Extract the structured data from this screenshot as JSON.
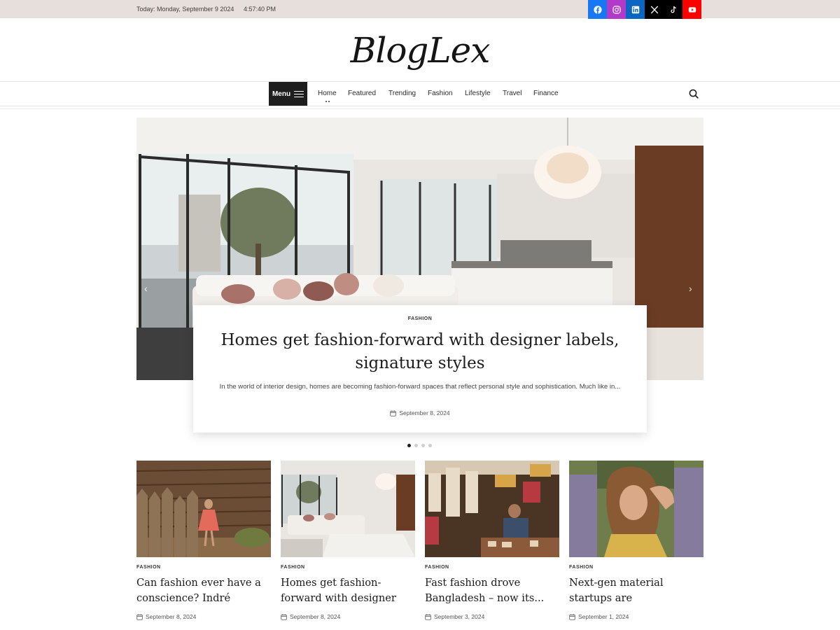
{
  "topbar": {
    "date": "Today: Monday, September 9 2024",
    "time": "4:57:40 PM",
    "social": [
      {
        "name": "facebook-icon",
        "color": "#1877f2"
      },
      {
        "name": "instagram-icon",
        "color": "#b23ac9"
      },
      {
        "name": "linkedin-icon",
        "color": "#0a66c2"
      },
      {
        "name": "x-icon",
        "color": "#000000"
      },
      {
        "name": "tiktok-icon",
        "color": "#000000"
      },
      {
        "name": "youtube-icon",
        "color": "#ff0000"
      }
    ]
  },
  "logo": "BlogLex",
  "nav": {
    "menu_label": "Menu",
    "items": [
      "Home",
      "Featured",
      "Trending",
      "Fashion",
      "Lifestyle",
      "Travel",
      "Finance"
    ],
    "search_icon": "search-icon"
  },
  "hero": {
    "category": "FASHION",
    "title": "Homes get fashion-forward with designer labels, signature styles",
    "excerpt": "In the world of interior design, homes are becoming fashion-forward spaces that reflect personal style and sophistication. Much like in...",
    "date": "September 8, 2024",
    "slides_total": 4,
    "active_slide": 1
  },
  "posts": [
    {
      "category": "FASHION",
      "title": "Can fashion ever have a conscience? Indré Rockefell...",
      "date": "September 8, 2024"
    },
    {
      "category": "FASHION",
      "title": "Homes get fashion-forward with designer labels,...",
      "date": "September 8, 2024"
    },
    {
      "category": "FASHION",
      "title": "Fast fashion drove Bangladesh – now its...",
      "date": "September 3, 2024"
    },
    {
      "category": "FASHION",
      "title": "Next-gen material startups are deprioritising fashion",
      "date": "September 1, 2024"
    }
  ],
  "colors": {
    "topbar_bg": "#e7dfdb",
    "menu_bg": "#1e1e1e",
    "text": "#1b1b1b"
  }
}
